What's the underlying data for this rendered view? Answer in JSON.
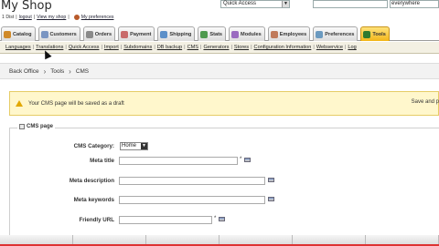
{
  "header": {
    "shop_title": "My Shop",
    "top_links": [
      {
        "text": "1 Dist",
        "link": false
      },
      {
        "text": "|",
        "link": false
      },
      {
        "text": "logout",
        "link": true
      },
      {
        "text": "|",
        "link": false
      },
      {
        "text": "View my shop",
        "link": true
      },
      {
        "text": "|",
        "link": false
      },
      {
        "text": "My preferences",
        "link": true
      }
    ],
    "quick_access": "Quick Access",
    "search_placeholder": "",
    "search_scope": "everywhere"
  },
  "tabs": [
    {
      "label": "Catalog",
      "color": "#d08a2a",
      "active": false
    },
    {
      "label": "Customers",
      "color": "#7a95c2",
      "active": false
    },
    {
      "label": "Orders",
      "color": "#8a8a8a",
      "active": false
    },
    {
      "label": "Payment",
      "color": "#c96b6b",
      "active": false
    },
    {
      "label": "Shipping",
      "color": "#5b8fc9",
      "active": false
    },
    {
      "label": "Stats",
      "color": "#4f9a4f",
      "active": false
    },
    {
      "label": "Modules",
      "color": "#9a6bc0",
      "active": false
    },
    {
      "label": "Employees",
      "color": "#c07a5a",
      "active": false
    },
    {
      "label": "Preferences",
      "color": "#6b9ac0",
      "active": false
    },
    {
      "label": "Tools",
      "color": "#2f7a2f",
      "active": true
    }
  ],
  "subtabs": [
    "Languages",
    "Translations",
    "Quick Access",
    "Import",
    "Subdomains",
    "DB backup",
    "CMS",
    "Generators",
    "Stores",
    "Configuration Information",
    "Webservice",
    "Log"
  ],
  "breadcrumb": [
    "Back Office",
    "Tools",
    "CMS"
  ],
  "draft_notice": {
    "text": "Your CMS page will be saved as a draft",
    "save_label": "Save and p"
  },
  "form": {
    "legend": "CMS page",
    "category_label": "CMS Category:",
    "category_value": "Home",
    "meta_title_label": "Meta title",
    "meta_description_label": "Meta description",
    "meta_keywords_label": "Meta keywords",
    "friendly_url_label": "Friendly URL",
    "required_marker": "*"
  }
}
